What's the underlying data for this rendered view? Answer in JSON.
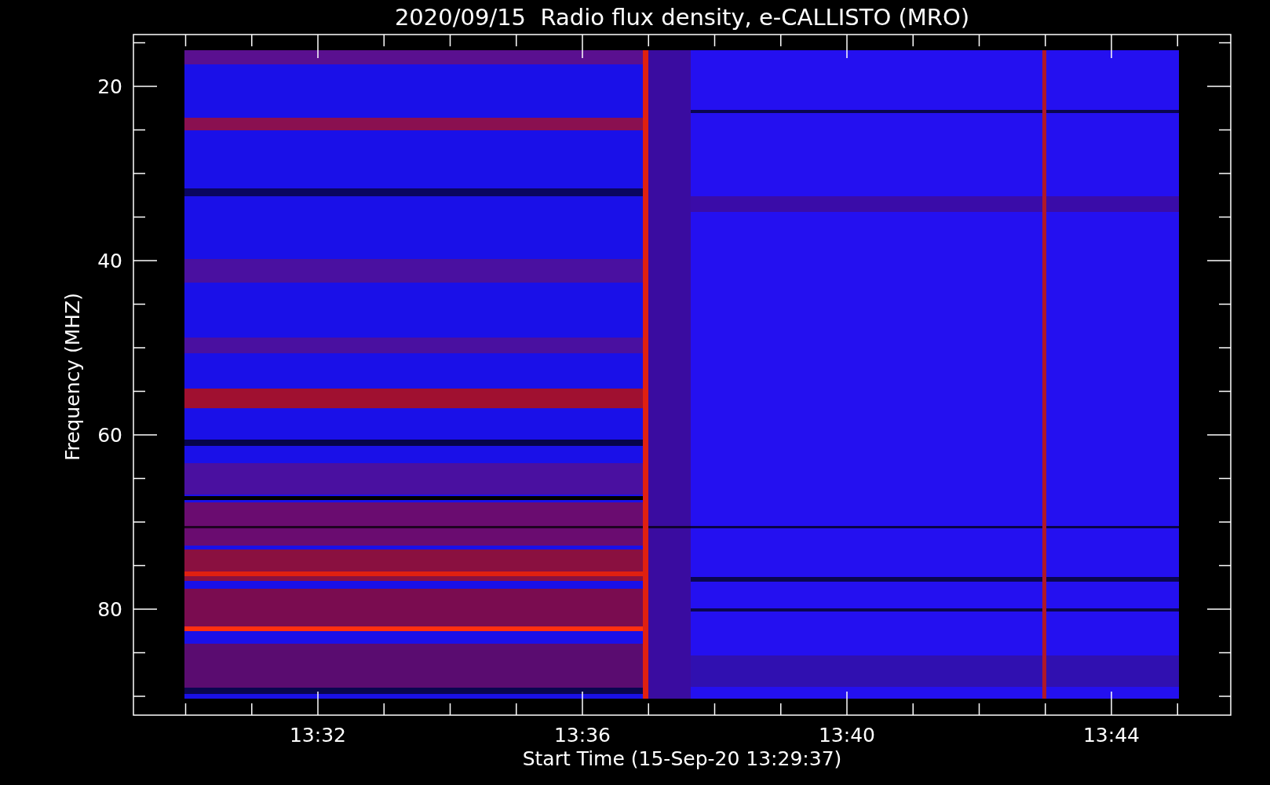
{
  "plot": {
    "title": "2020/09/15  Radio flux density, e-CALLISTO (MRO)",
    "ylabel": "Frequency (MHZ)",
    "xlabel": "Start Time (15-Sep-20 13:29:37)",
    "yticks": [
      "20",
      "40",
      "60",
      "80"
    ],
    "xticks": [
      "13:32",
      "13:36",
      "13:40",
      "13:44"
    ]
  }
}
